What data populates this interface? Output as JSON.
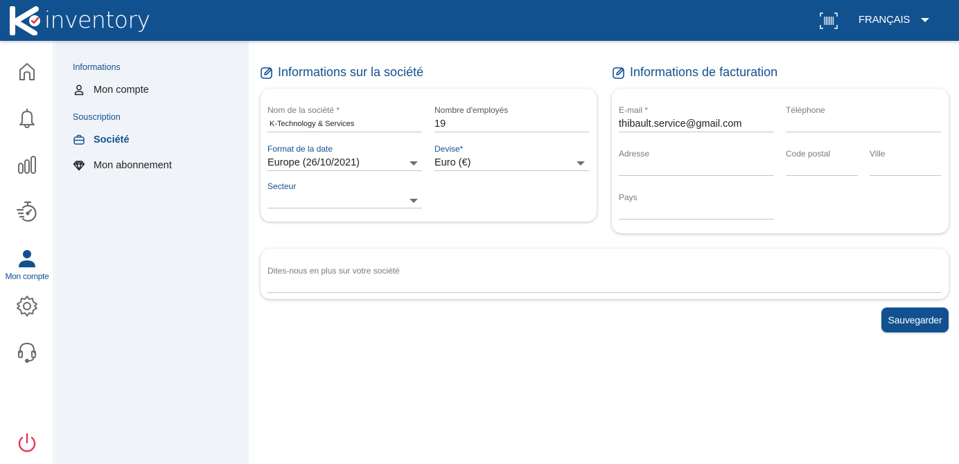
{
  "app": {
    "brand": "inventory",
    "colors": {
      "primary": "#12518f",
      "logout": "#e8334f",
      "sidebar_bg": "#f0f4f9"
    }
  },
  "header": {
    "scanner_icon": "barcode-scan-icon",
    "language": "FRANÇAIS"
  },
  "rail": {
    "items": [
      {
        "icon": "home-icon",
        "label": ""
      },
      {
        "icon": "bell-icon",
        "label": ""
      },
      {
        "icon": "chart-bars-icon",
        "label": ""
      },
      {
        "icon": "stopwatch-fast-icon",
        "label": ""
      },
      {
        "icon": "user-icon",
        "label": "Mon compte",
        "active": true
      },
      {
        "icon": "gear-icon",
        "label": ""
      },
      {
        "icon": "headset-icon",
        "label": ""
      },
      {
        "icon": "power-icon",
        "label": ""
      }
    ]
  },
  "subnav": {
    "sections": [
      {
        "title": "Informations",
        "items": [
          {
            "icon": "user-outline-icon",
            "label": "Mon compte"
          }
        ]
      },
      {
        "title": "Souscription",
        "items": [
          {
            "icon": "briefcase-icon",
            "label": "Société",
            "active": true
          },
          {
            "icon": "diamond-icon",
            "label": "Mon abonnement"
          }
        ]
      }
    ]
  },
  "company": {
    "title": "Informations sur la société",
    "fields": {
      "name": {
        "label": "Nom de la société *",
        "value": "K-Technology & Services"
      },
      "employees": {
        "label": "Nombre d'employés",
        "value": "19"
      },
      "date_format": {
        "label": "Format de la date",
        "value": "Europe (26/10/2021)"
      },
      "currency": {
        "label": "Devise*",
        "value": "Euro (€)"
      },
      "sector": {
        "label": "Secteur",
        "value": ""
      }
    }
  },
  "billing": {
    "title": "Informations de facturation",
    "fields": {
      "email": {
        "label": "E-mail *",
        "value": "thibault.service@gmail.com"
      },
      "phone": {
        "label": "Téléphone",
        "value": ""
      },
      "address": {
        "label": "Adresse",
        "value": ""
      },
      "postal_code": {
        "label": "Code postal",
        "value": ""
      },
      "city": {
        "label": "Ville",
        "value": ""
      },
      "country": {
        "label": "Pays",
        "value": ""
      }
    }
  },
  "about": {
    "label": "Dites-nous en plus sur votre société",
    "value": ""
  },
  "actions": {
    "save": "Sauvegarder"
  }
}
